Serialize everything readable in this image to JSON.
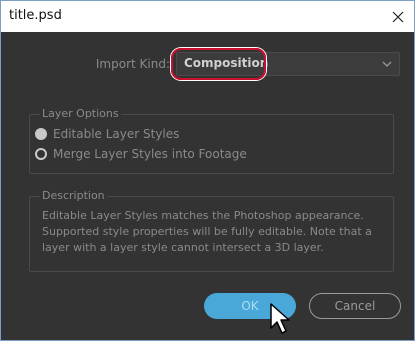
{
  "window": {
    "title": "title.psd"
  },
  "import": {
    "label": "Import Kind:",
    "selected": "Composition"
  },
  "layer_options": {
    "legend": "Layer Options",
    "options": [
      {
        "label": "Editable Layer Styles",
        "selected": true
      },
      {
        "label": "Merge Layer Styles into Footage",
        "selected": false
      }
    ]
  },
  "description": {
    "legend": "Description",
    "text": "Editable Layer Styles matches the Photoshop appearance. Supported style properties will be fully editable. Note that a layer with a layer style cannot intersect a 3D layer."
  },
  "buttons": {
    "ok": "OK",
    "cancel": "Cancel"
  },
  "colors": {
    "accent": "#4aa8d8",
    "highlight": "#c8102e",
    "window_border": "#7a9fc3"
  },
  "icons": {
    "close": "close-icon",
    "dropdown": "chevron-down-icon",
    "pointer": "mouse-pointer-icon"
  }
}
